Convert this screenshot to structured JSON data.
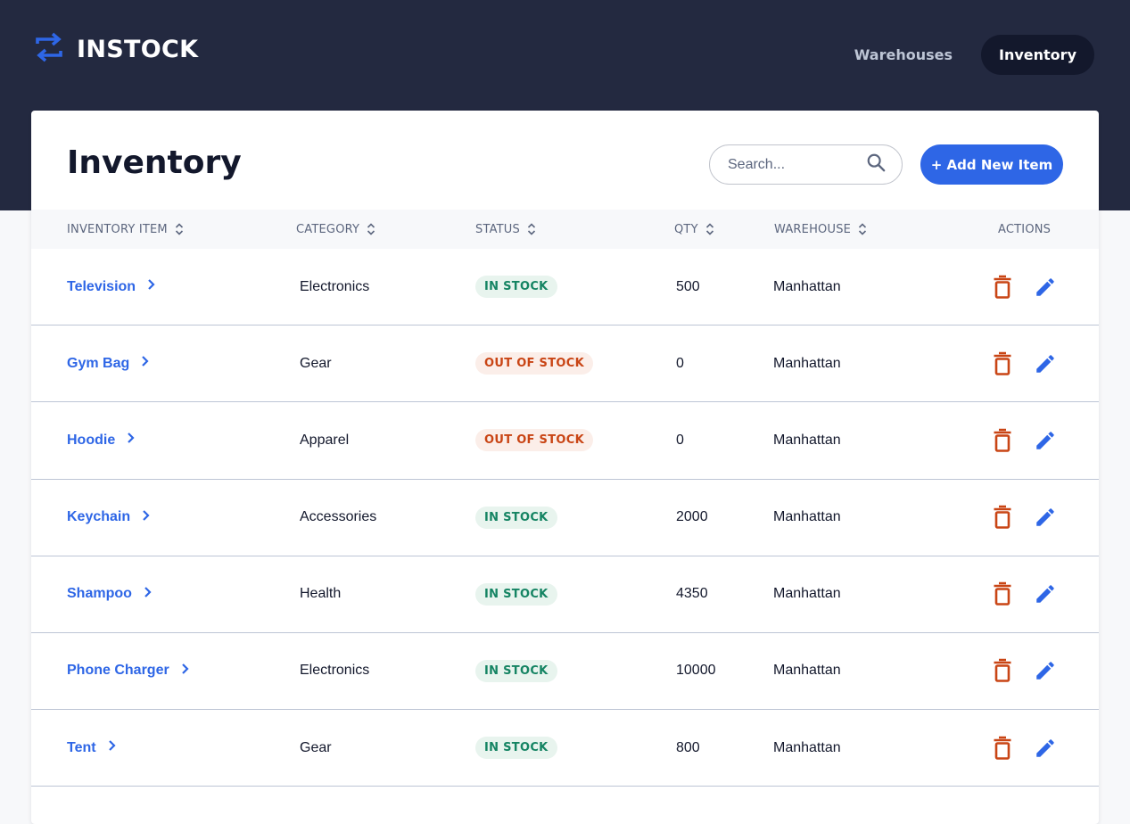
{
  "brand": {
    "name": "INSTOCK"
  },
  "nav": [
    {
      "label": "Warehouses",
      "active": false
    },
    {
      "label": "Inventory",
      "active": true
    }
  ],
  "page": {
    "title": "Inventory",
    "search_placeholder": "Search...",
    "add_button": "+ Add New Item"
  },
  "columns": {
    "item": "INVENTORY ITEM",
    "category": "CATEGORY",
    "status": "STATUS",
    "qty": "QTY",
    "warehouse": "WAREHOUSE",
    "actions": "ACTIONS"
  },
  "rows": [
    {
      "name": "Television",
      "category": "Electronics",
      "status": "IN STOCK",
      "in_stock": true,
      "qty": "500",
      "warehouse": "Manhattan"
    },
    {
      "name": "Gym Bag",
      "category": "Gear",
      "status": "OUT OF STOCK",
      "in_stock": false,
      "qty": "0",
      "warehouse": "Manhattan"
    },
    {
      "name": "Hoodie",
      "category": "Apparel",
      "status": "OUT OF STOCK",
      "in_stock": false,
      "qty": "0",
      "warehouse": "Manhattan"
    },
    {
      "name": "Keychain",
      "category": "Accessories",
      "status": "IN STOCK",
      "in_stock": true,
      "qty": "2000",
      "warehouse": "Manhattan"
    },
    {
      "name": "Shampoo",
      "category": "Health",
      "status": "IN STOCK",
      "in_stock": true,
      "qty": "4350",
      "warehouse": "Manhattan"
    },
    {
      "name": "Phone Charger",
      "category": "Electronics",
      "status": "IN STOCK",
      "in_stock": true,
      "qty": "10000",
      "warehouse": "Manhattan"
    },
    {
      "name": "Tent",
      "category": "Gear",
      "status": "IN STOCK",
      "in_stock": true,
      "qty": "800",
      "warehouse": "Manhattan"
    }
  ],
  "colors": {
    "header_bg": "#232940",
    "accent": "#2e66e6",
    "in_stock_text": "#158463",
    "out_of_stock_text": "#c94515",
    "delete_icon": "#c94515"
  },
  "icons": {
    "logo": "swap-arrows-icon",
    "search": "search-icon",
    "sort": "sort-icon",
    "chevron": "chevron-right-icon",
    "delete": "trash-icon",
    "edit": "pencil-icon"
  }
}
